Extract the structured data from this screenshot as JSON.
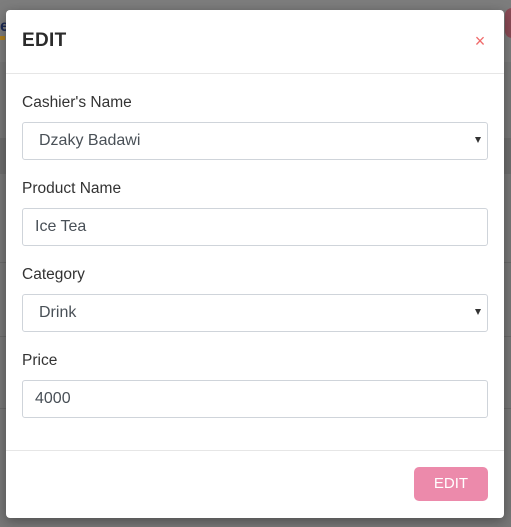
{
  "modal": {
    "title": "EDIT",
    "close_glyph": "×",
    "fields": {
      "cashier": {
        "label": "Cashier's Name",
        "value": "Dzaky Badawi"
      },
      "product": {
        "label": "Product Name",
        "value": "Ice Tea"
      },
      "category": {
        "label": "Category",
        "value": "Drink"
      },
      "price": {
        "label": "Price",
        "value": "4000"
      }
    },
    "submit_label": "EDIT"
  },
  "background": {
    "logo_fragment": "e"
  },
  "colors": {
    "accent": "#ec8aab",
    "close": "#f06a6a"
  },
  "icons": {
    "close": "close-icon",
    "select_caret": "chevron-down-icon"
  }
}
